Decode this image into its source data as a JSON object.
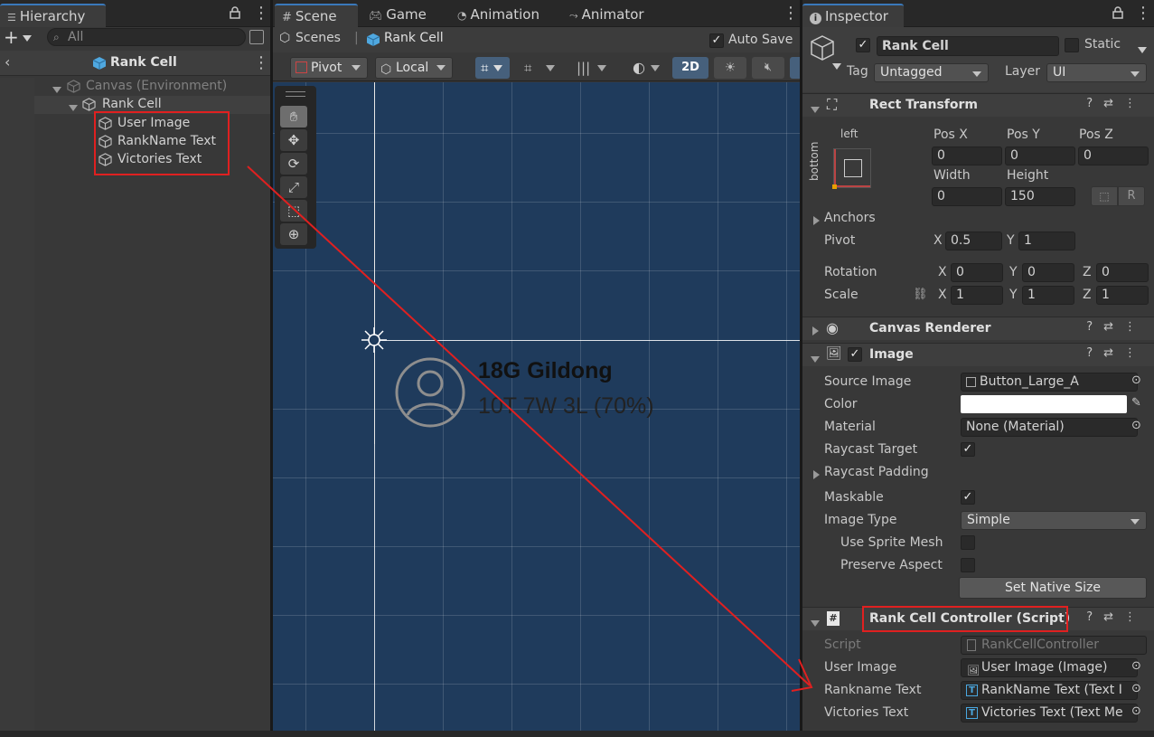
{
  "hierarchy": {
    "tab_label": "Hierarchy",
    "search_placeholder": "All",
    "scene_title": "Rank Cell",
    "items": [
      {
        "label": "Canvas (Environment)"
      },
      {
        "label": "Rank Cell"
      },
      {
        "label": "User Image"
      },
      {
        "label": "RankName Text"
      },
      {
        "label": "Victories Text"
      }
    ]
  },
  "scene_tabs": {
    "scene": "Scene",
    "game": "Game",
    "animation": "Animation",
    "animator": "Animator"
  },
  "scene_breadcrumb": {
    "scenes": "Scenes",
    "current": "Rank Cell",
    "auto_save": "Auto Save",
    "auto_save_checked": true
  },
  "scene_toolbar": {
    "pivot": "Pivot",
    "local": "Local",
    "mode_2d": "2D"
  },
  "scene_view": {
    "rank_name": "18G Gildong",
    "victories": "10T 7W 3L (70%)",
    "bg_color": "#1f3b5c"
  },
  "inspector": {
    "tab_label": "Inspector",
    "object_name": "Rank Cell",
    "static_label": "Static",
    "tag_label": "Tag",
    "tag_value": "Untagged",
    "layer_label": "Layer",
    "layer_value": "UI",
    "rect_transform": {
      "title": "Rect Transform",
      "anchor_h": "left",
      "anchor_v": "bottom",
      "pos_x_label": "Pos X",
      "pos_x": "0",
      "pos_y_label": "Pos Y",
      "pos_y": "0",
      "pos_z_label": "Pos Z",
      "pos_z": "0",
      "width_label": "Width",
      "width": "0",
      "height_label": "Height",
      "height": "150",
      "anchors_label": "Anchors",
      "pivot_label": "Pivot",
      "pivot_x": "0.5",
      "pivot_y": "1",
      "rotation_label": "Rotation",
      "rot_x": "0",
      "rot_y": "0",
      "rot_z": "0",
      "scale_label": "Scale",
      "scale_x": "1",
      "scale_y": "1",
      "scale_z": "1",
      "axis_x": "X",
      "axis_y": "Y",
      "axis_z": "Z",
      "r_button": "R"
    },
    "canvas_renderer": {
      "title": "Canvas Renderer"
    },
    "image": {
      "title": "Image",
      "source_image_label": "Source Image",
      "source_image": "Button_Large_A",
      "color_label": "Color",
      "material_label": "Material",
      "material": "None (Material)",
      "raycast_target_label": "Raycast Target",
      "raycast_padding_label": "Raycast Padding",
      "maskable_label": "Maskable",
      "image_type_label": "Image Type",
      "image_type": "Simple",
      "use_sprite_mesh_label": "Use Sprite Mesh",
      "preserve_aspect_label": "Preserve Aspect",
      "set_native_size": "Set Native Size"
    },
    "rank_cell_controller": {
      "title": "Rank Cell Controller (Script)",
      "script_label": "Script",
      "script_value": "RankCellController",
      "user_image_label": "User Image",
      "user_image_value": "User Image (Image)",
      "rankname_label": "Rankname Text",
      "rankname_value": "RankName Text (Text I",
      "victories_label": "Victories Text",
      "victories_value": "Victories Text (Text Me"
    }
  },
  "colors": {
    "accent": "#3a79bb",
    "annotation_red": "#e02020"
  }
}
